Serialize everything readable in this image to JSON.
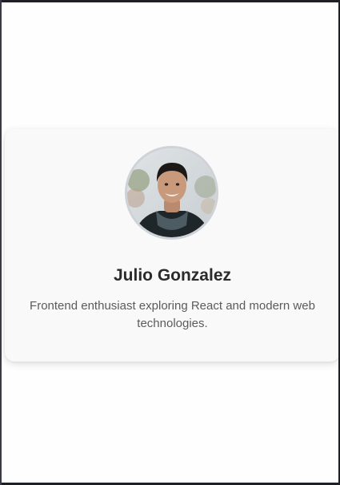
{
  "profile": {
    "name": "Julio Gonzalez",
    "bio": "Frontend enthusiast exploring React and modern web technologies.",
    "avatar_icon": "profile-photo"
  },
  "colors": {
    "card_background": "#f9f9f9",
    "avatar_border": "#cfd3d8",
    "name_text": "#2b2b2b",
    "bio_text": "#5b5b5b"
  }
}
